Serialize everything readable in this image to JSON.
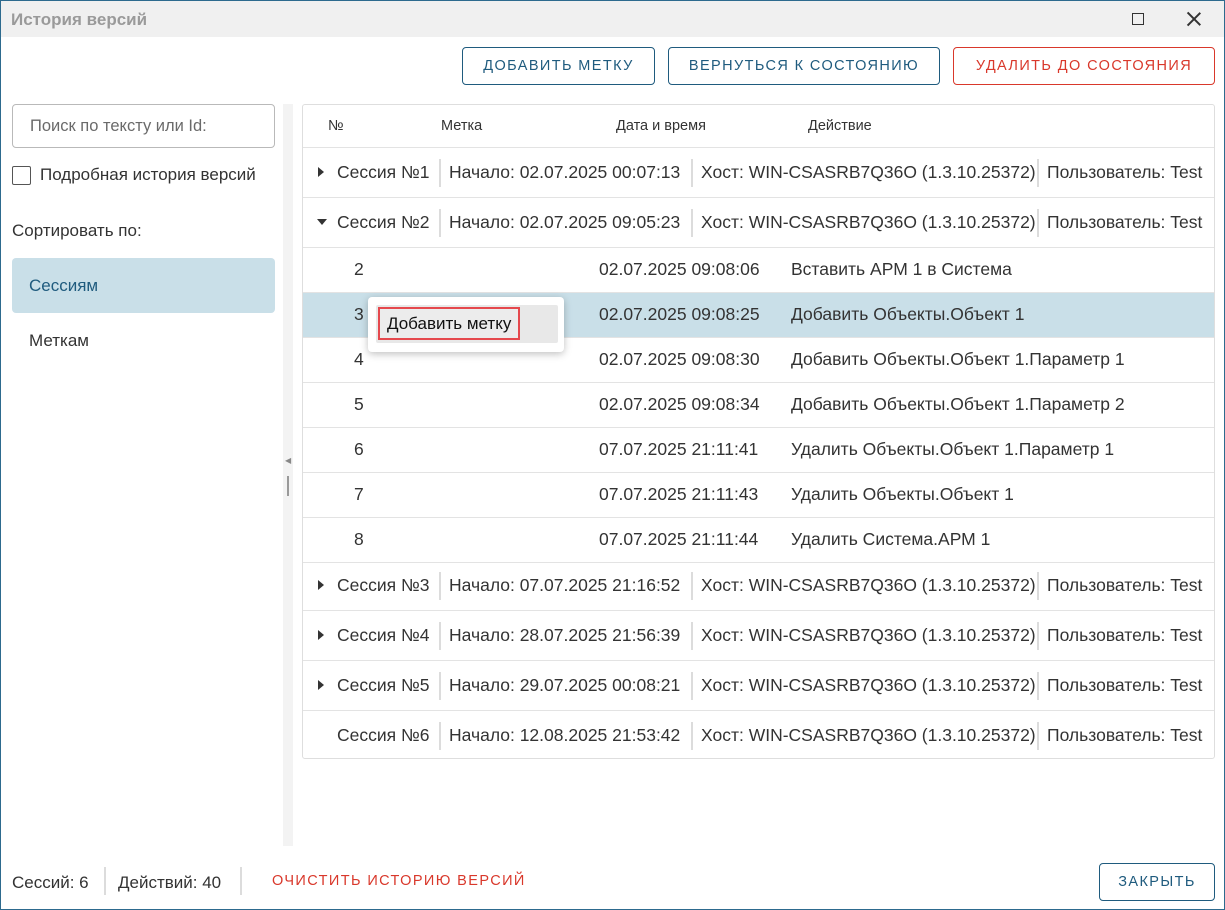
{
  "window": {
    "title": "История версий"
  },
  "toolbar": {
    "add_mark": "Добавить метку",
    "revert": "Вернуться к состоянию",
    "delete_to": "Удалить до состояния"
  },
  "sidebar": {
    "search_placeholder": "Поиск по тексту или Id:",
    "detailed_label": "Подробная история версий",
    "detailed_checked": false,
    "sort_label": "Сортировать по:",
    "sort_options": [
      "Сессиям",
      "Меткам"
    ],
    "sort_selected": "Сессиям"
  },
  "table": {
    "headers": {
      "num": "№",
      "mark": "Метка",
      "date": "Дата и время",
      "action": "Действие"
    },
    "sessions": [
      {
        "name": "Сессия №1",
        "start": "Начало: 02.07.2025 00:07:13",
        "host": "Хост: WIN-CSASRB7Q36O (1.3.10.25372)",
        "user": "Пользователь: Test",
        "expanded": false
      },
      {
        "name": "Сессия №2",
        "start": "Начало: 02.07.2025 09:05:23",
        "host": "Хост: WIN-CSASRB7Q36O (1.3.10.25372)",
        "user": "Пользователь: Test",
        "expanded": true
      },
      {
        "name": "Сессия №3",
        "start": "Начало: 07.07.2025 21:16:52",
        "host": "Хост: WIN-CSASRB7Q36O (1.3.10.25372)",
        "user": "Пользователь: Test",
        "expanded": false
      },
      {
        "name": "Сессия №4",
        "start": "Начало: 28.07.2025 21:56:39",
        "host": "Хост: WIN-CSASRB7Q36O (1.3.10.25372)",
        "user": "Пользователь: Test",
        "expanded": false
      },
      {
        "name": "Сессия №5",
        "start": "Начало: 29.07.2025 00:08:21",
        "host": "Хост: WIN-CSASRB7Q36O (1.3.10.25372)",
        "user": "Пользователь: Test",
        "expanded": false
      },
      {
        "name": "Сессия №6",
        "start": "Начало: 12.08.2025 21:53:42",
        "host": "Хост: WIN-CSASRB7Q36O (1.3.10.25372)",
        "user": "Пользователь: Test",
        "expanded": false
      }
    ],
    "actions": [
      {
        "num": "2",
        "date": "02.07.2025 09:08:06",
        "action": "Вставить АРМ 1 в Система",
        "selected": false
      },
      {
        "num": "3",
        "date": "02.07.2025 09:08:25",
        "action": "Добавить Объекты.Объект 1",
        "selected": true
      },
      {
        "num": "4",
        "date": "02.07.2025 09:08:30",
        "action": "Добавить Объекты.Объект 1.Параметр 1",
        "selected": false
      },
      {
        "num": "5",
        "date": "02.07.2025 09:08:34",
        "action": "Добавить Объекты.Объект 1.Параметр 2",
        "selected": false
      },
      {
        "num": "6",
        "date": "07.07.2025 21:11:41",
        "action": "Удалить Объекты.Объект 1.Параметр 1",
        "selected": false
      },
      {
        "num": "7",
        "date": "07.07.2025 21:11:43",
        "action": "Удалить Объекты.Объект 1",
        "selected": false
      },
      {
        "num": "8",
        "date": "07.07.2025 21:11:44",
        "action": "Удалить Система.АРМ 1",
        "selected": false
      }
    ]
  },
  "context_menu": {
    "items": [
      "Добавить метку"
    ]
  },
  "footer": {
    "sessions": "Сессий: 6",
    "actions": "Действий: 40",
    "clear": "Очистить историю версий",
    "close": "Закрыть"
  },
  "colors": {
    "accent": "#1f5b7e",
    "danger": "#d9382b",
    "selection": "#c9dfe8",
    "highlight_border": "#e5484d"
  }
}
